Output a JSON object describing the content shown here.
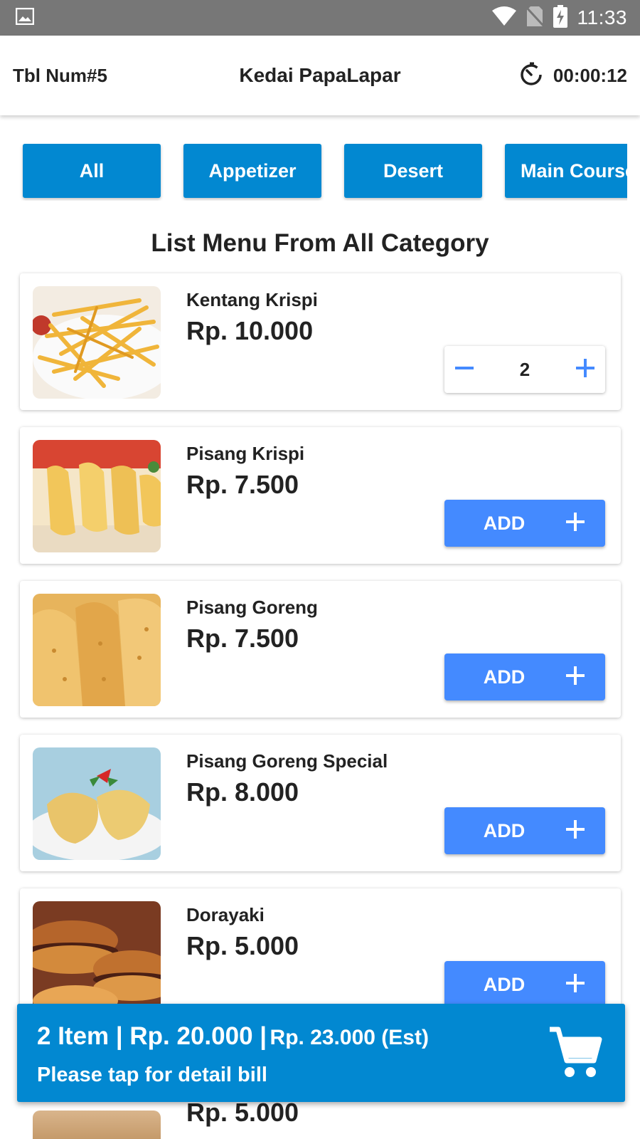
{
  "status_bar": {
    "time": "11:33"
  },
  "header": {
    "table_number": "Tbl Num#5",
    "shop_name": "Kedai PapaLapar",
    "timer": "00:00:12"
  },
  "tabs": [
    {
      "label": "All"
    },
    {
      "label": "Appetizer"
    },
    {
      "label": "Desert"
    },
    {
      "label": "Main Course"
    }
  ],
  "section_title": "List Menu From All Category",
  "menu_items": [
    {
      "name": "Kentang Krispi",
      "price": "Rp. 10.000",
      "quantity": "2",
      "in_cart": true
    },
    {
      "name": "Pisang Krispi",
      "price": "Rp. 7.500",
      "add_label": "ADD",
      "in_cart": false
    },
    {
      "name": "Pisang Goreng",
      "price": "Rp. 7.500",
      "add_label": "ADD",
      "in_cart": false
    },
    {
      "name": "Pisang Goreng Special",
      "price": "Rp. 8.000",
      "add_label": "ADD",
      "in_cart": false
    },
    {
      "name": "Dorayaki",
      "price": "Rp. 5.000",
      "add_label": "ADD",
      "in_cart": false
    }
  ],
  "peek_item": {
    "price": "Rp. 5.000"
  },
  "cart": {
    "summary": "2 Item | Rp. 20.000 |",
    "estimate": "Rp. 23.000 (Est)",
    "hint": "Please tap for detail bill"
  },
  "colors": {
    "status_bar": "#777777",
    "tab_blue": "#0288d1",
    "add_button": "#448aff",
    "cart_bar": "#0288d1"
  },
  "icons": [
    "image-icon",
    "wifi-icon",
    "no-sim-icon",
    "battery-charging-icon",
    "timer-icon",
    "minus-icon",
    "plus-icon",
    "cart-icon"
  ]
}
